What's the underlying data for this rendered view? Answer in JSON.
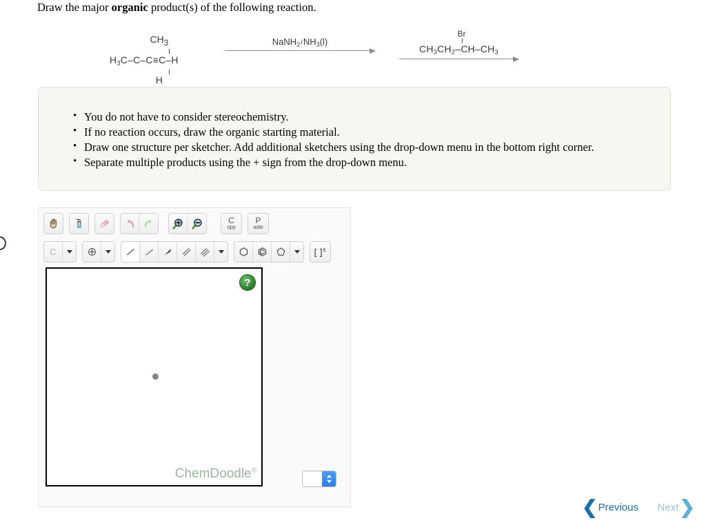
{
  "prompt": {
    "before": "Draw the major ",
    "bold": "organic",
    "after": " product(s) of the following reaction."
  },
  "reaction": {
    "reactant": {
      "top_group": "CH",
      "top_group_sub": "3",
      "left": "H",
      "left_sub": "3",
      "left_tail": "C–",
      "center": "C",
      "chain_tail": "–C≡C–H",
      "bottom_group": "H"
    },
    "step1": {
      "reagent_a": "NaNH",
      "reagent_a_sub": "2",
      "separator": "/",
      "reagent_b": "NH",
      "reagent_b_sub": "3",
      "reagent_b_state": "(l)"
    },
    "step2": {
      "substituent": "Br",
      "chain_left": "CH",
      "chain_left_sub": "3",
      "chain_mid": "CH",
      "chain_mid_sub": "2",
      "chain_link": "–",
      "chain_center": "CH",
      "chain_right_link": "–CH",
      "chain_right_sub": "3"
    }
  },
  "instructions": [
    "You do not have to consider stereochemistry.",
    "If no reaction occurs, draw the organic starting material.",
    "Draw one structure per sketcher. Add additional sketchers using the drop-down menu in the bottom right corner.",
    "Separate multiple products using the + sign from the drop-down menu."
  ],
  "sketcher": {
    "toolbar_row1": [
      {
        "name": "hand-tool",
        "icon": "hand-icon"
      },
      {
        "name": "clear-tool",
        "icon": "spray-bottle-icon"
      },
      {
        "name": "eraser-tool",
        "icon": "eraser-icon"
      },
      {
        "name": "undo-tool",
        "icon": "undo-arrow-icon"
      },
      {
        "name": "redo-tool",
        "icon": "redo-arrow-icon"
      },
      {
        "name": "zoom-in-tool",
        "icon": "magnifier-plus-icon"
      },
      {
        "name": "zoom-out-tool",
        "icon": "magnifier-minus-icon"
      }
    ],
    "copy_label_top": "C",
    "copy_label_bottom": "opy",
    "paste_label_top": "P",
    "paste_label_bottom": "aste",
    "element_label": "C",
    "charge_label": "⊕",
    "bracket_label": "[ ]",
    "bracket_sup": "±",
    "canvas": {
      "help_label": "?",
      "watermark": "ChemDoodle",
      "watermark_sup": "®"
    },
    "add_sketcher_value": ""
  },
  "pager": {
    "previous_label": "Previous",
    "next_label": "Next",
    "prev_chevron": "❮",
    "next_chevron": "❯"
  },
  "colors": {
    "accent_blue": "#1a6fa8",
    "disabled_blue": "#9dc4dc",
    "help_green": "#2d7a2d",
    "watermark_green": "#9bb79b",
    "panel_cream": "#f7f7f1"
  }
}
